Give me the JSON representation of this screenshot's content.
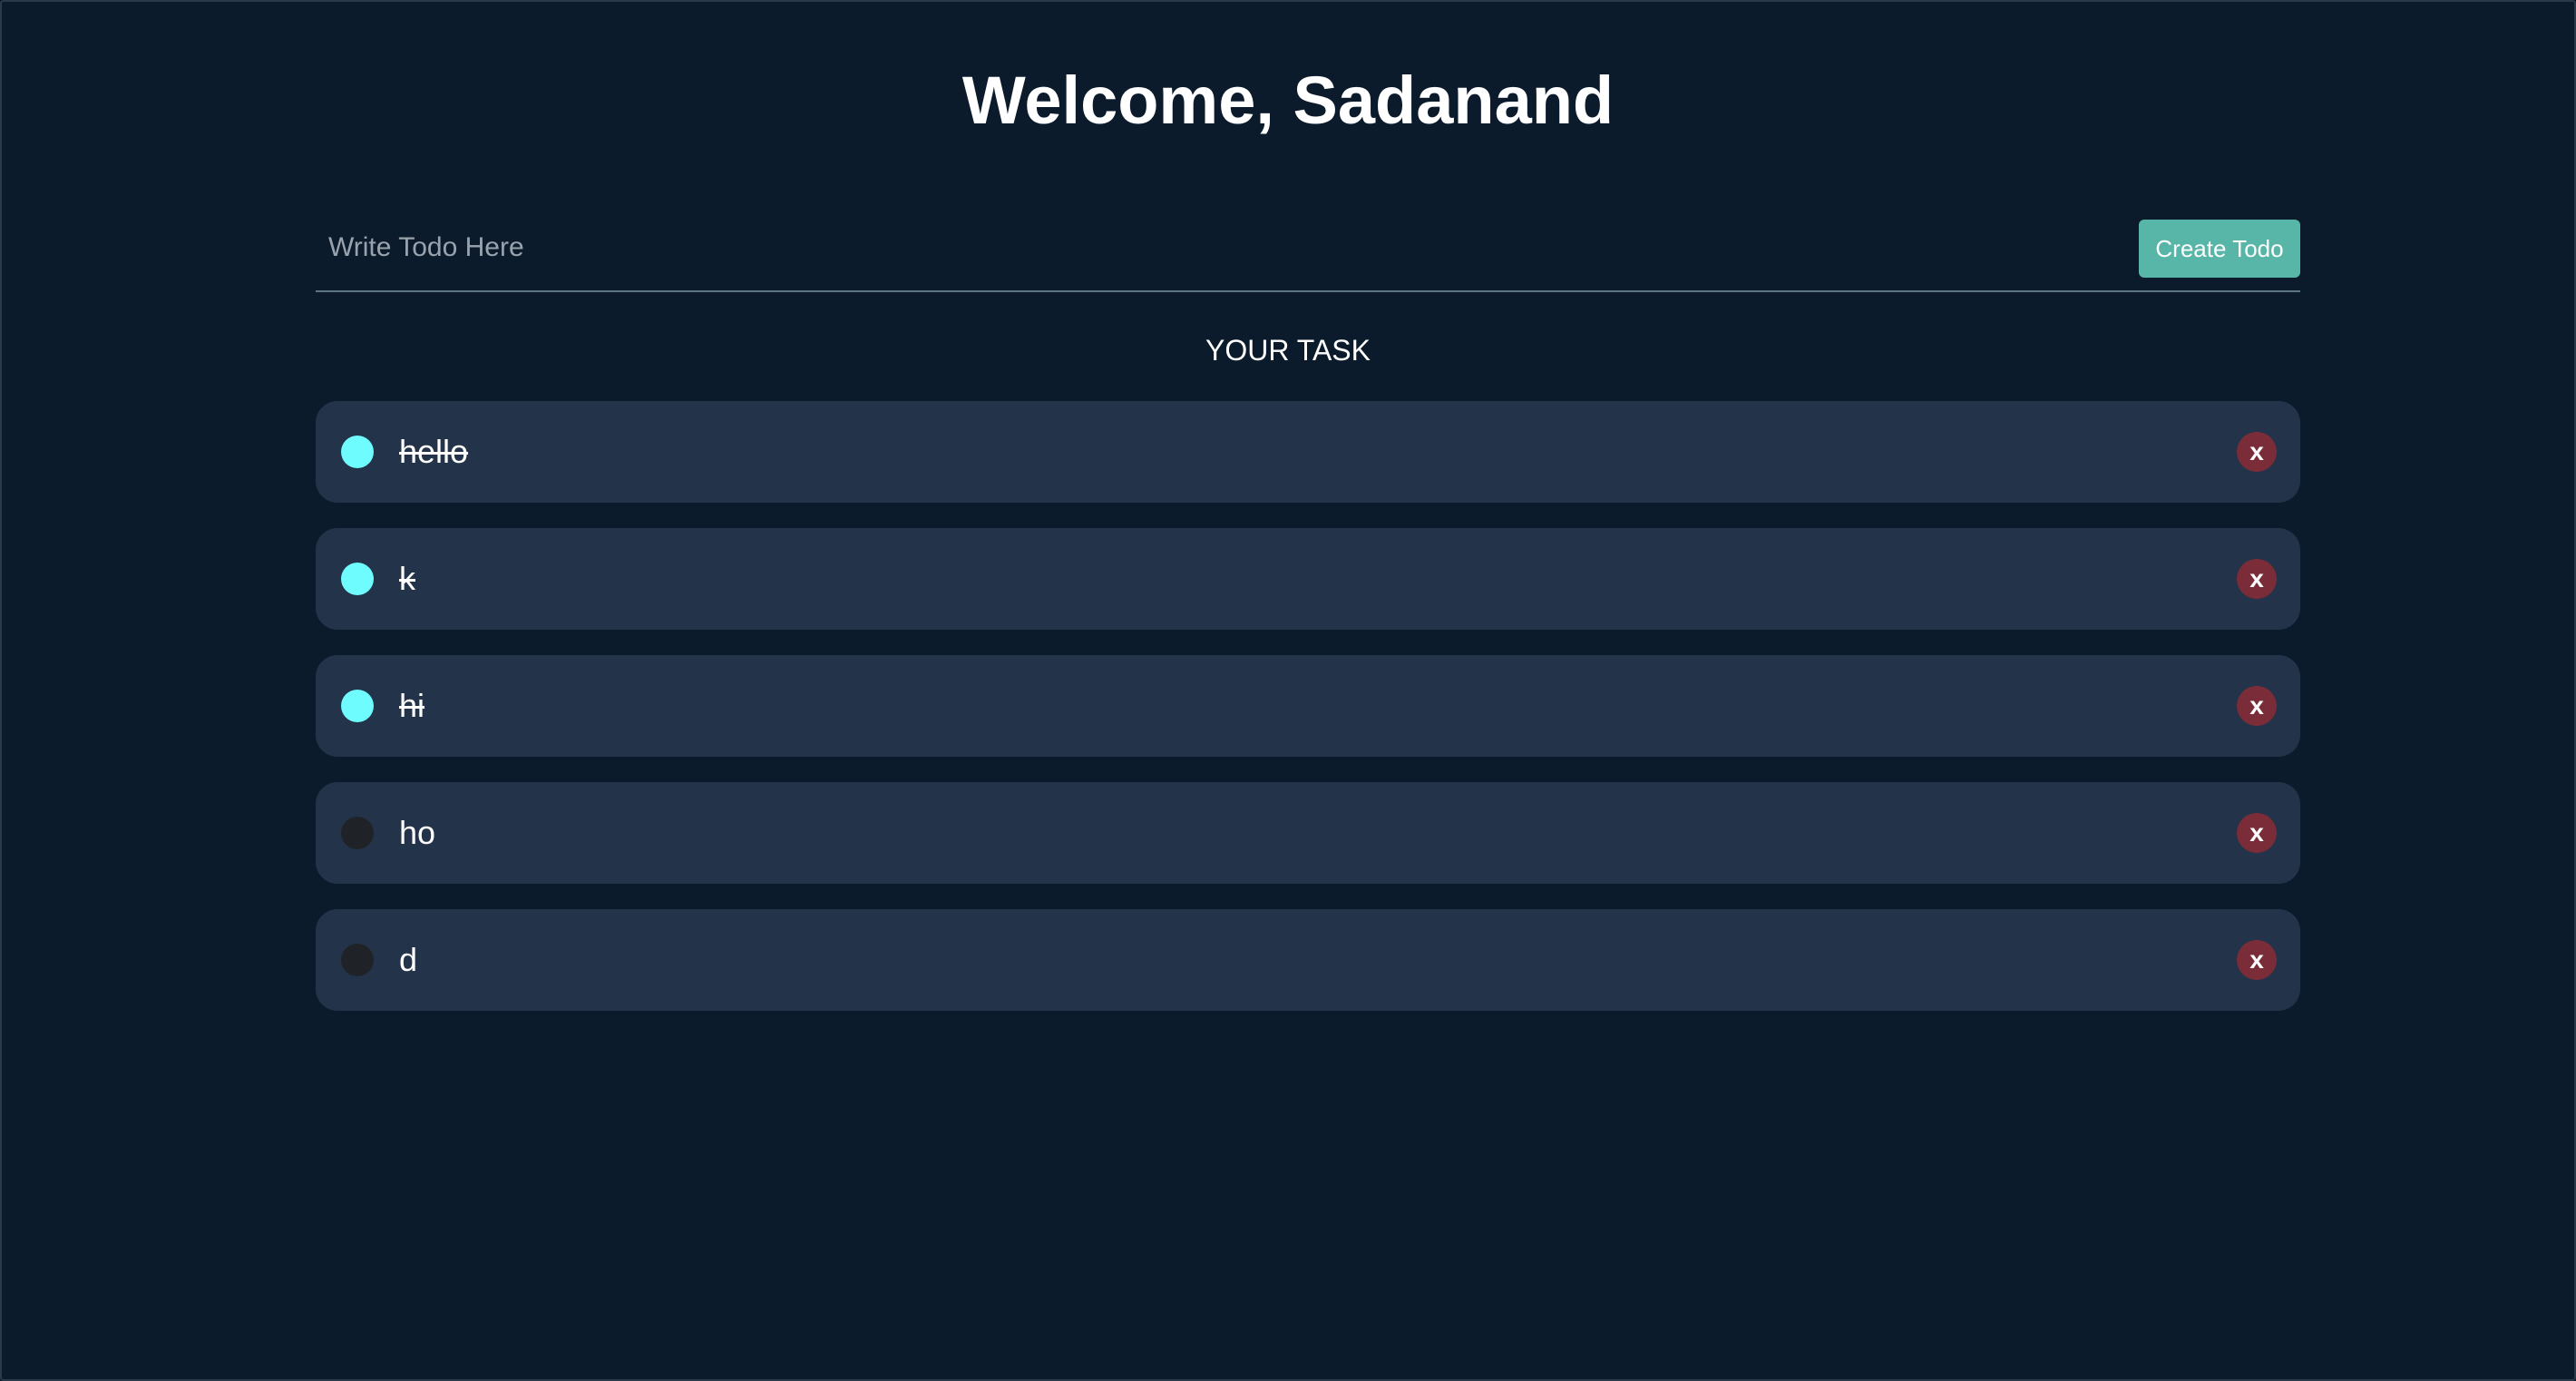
{
  "header": {
    "title": "Welcome, Sadanand"
  },
  "form": {
    "placeholder": "Write Todo Here",
    "value": "",
    "create_label": "Create Todo"
  },
  "tasks_section": {
    "title": "YOUR TASK"
  },
  "tasks": [
    {
      "text": "hello",
      "completed": true,
      "delete_label": "x"
    },
    {
      "text": "k",
      "completed": true,
      "delete_label": "x"
    },
    {
      "text": "hi",
      "completed": true,
      "delete_label": "x"
    },
    {
      "text": "ho",
      "completed": false,
      "delete_label": "x"
    },
    {
      "text": "d",
      "completed": false,
      "delete_label": "x"
    }
  ],
  "colors": {
    "background": "#0b1b2c",
    "card": "#233349",
    "accent": "#57b6a8",
    "done_dot": "#6ffcff",
    "open_dot": "#1f2328",
    "delete": "#7a2d38"
  }
}
